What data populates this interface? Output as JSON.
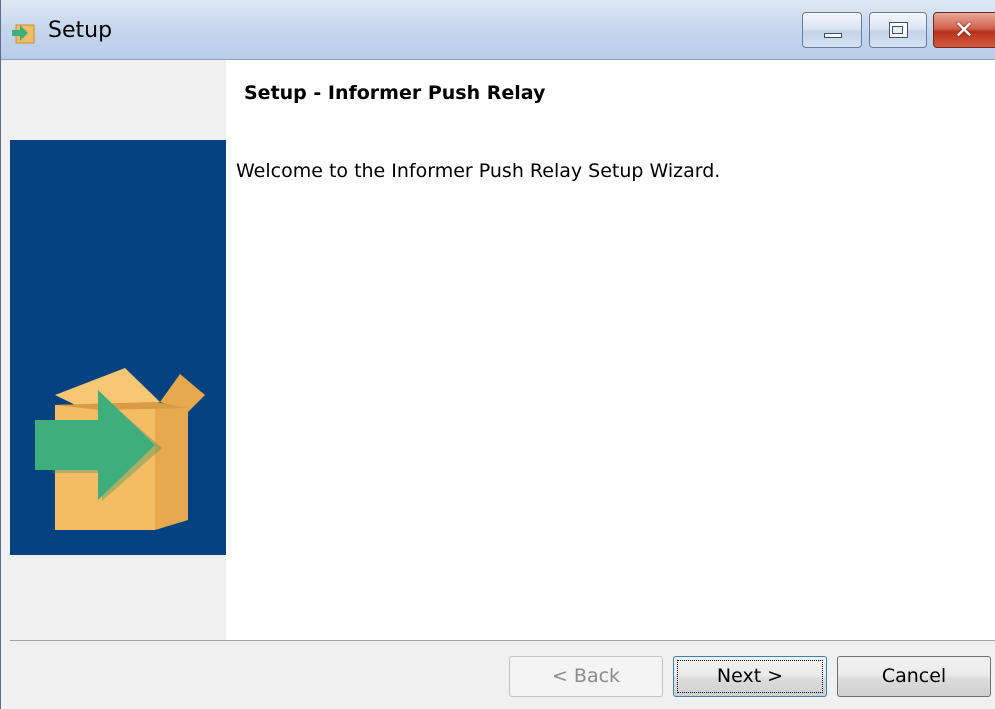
{
  "window": {
    "title": "Setup",
    "icon": "setup-arrow-icon"
  },
  "caption_buttons": {
    "minimize": "minimize-icon",
    "maximize": "maximize-icon",
    "close": "close-icon"
  },
  "wizard": {
    "heading": "Setup - Informer Push Relay",
    "welcome_text": "Welcome to the Informer Push Relay Setup Wizard.",
    "banner_image": "box-arrow-install-icon"
  },
  "buttons": {
    "back_label": "< Back",
    "next_label": "Next >",
    "cancel_label": "Cancel"
  },
  "colors": {
    "banner": "#034181",
    "box": "#f5bd63",
    "arrow": "#3dae7c"
  }
}
